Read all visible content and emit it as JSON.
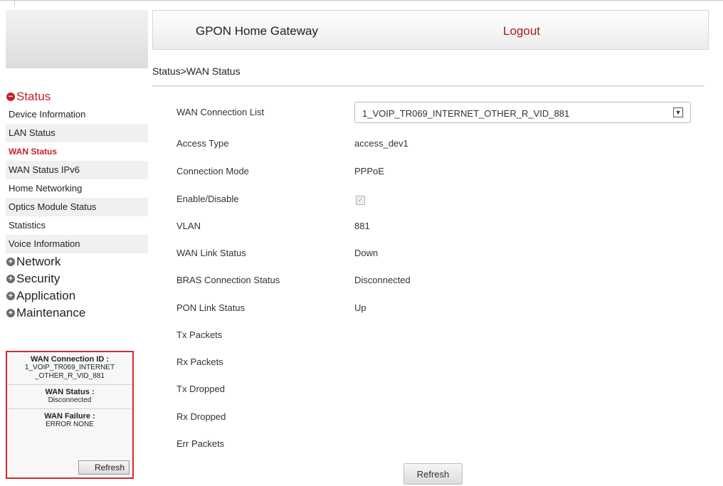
{
  "header": {
    "brand": "GPON Home Gateway",
    "logout": "Logout"
  },
  "breadcrumb": "Status>WAN Status",
  "sidebar": {
    "status": {
      "label": "Status",
      "items": [
        {
          "label": "Device Information"
        },
        {
          "label": "LAN Status"
        },
        {
          "label": "WAN Status"
        },
        {
          "label": "WAN Status IPv6"
        },
        {
          "label": "Home Networking"
        },
        {
          "label": "Optics Module Status"
        },
        {
          "label": "Statistics"
        },
        {
          "label": "Voice Information"
        }
      ]
    },
    "network": "Network",
    "security": "Security",
    "application": "Application",
    "maintenance": "Maintenance"
  },
  "infobox": {
    "conn_title": "WAN Connection ID :",
    "conn_value_1": "1_VOIP_TR069_INTERNET",
    "conn_value_2": "_OTHER_R_VID_881",
    "status_title": "WAN Status :",
    "status_value": "Disconnected",
    "failure_title": "WAN Failure :",
    "failure_value": "ERROR NONE",
    "refresh": "Refresh"
  },
  "main": {
    "conn_list_label": "WAN Connection List",
    "conn_list_value": "1_VOIP_TR069_INTERNET_OTHER_R_VID_881",
    "access_type_label": "Access Type",
    "access_type_value": "access_dev1",
    "conn_mode_label": "Connection Mode",
    "conn_mode_value": "PPPoE",
    "enable_label": "Enable/Disable",
    "enable_checked": true,
    "vlan_label": "VLAN",
    "vlan_value": "881",
    "wan_link_label": "WAN Link Status",
    "wan_link_value": "Down",
    "bras_label": "BRAS Connection Status",
    "bras_value": "Disconnected",
    "pon_label": "PON Link Status",
    "pon_value": "Up",
    "tx_packets_label": "Tx Packets",
    "rx_packets_label": "Rx Packets",
    "tx_dropped_label": "Tx Dropped",
    "rx_dropped_label": "Rx Dropped",
    "err_packets_label": "Err Packets",
    "refresh": "Refresh"
  },
  "icons": {
    "expanded": "minus-circle-icon",
    "collapsed": "plus-circle-icon",
    "dropdown": "chevron-down-icon",
    "check": "check-icon"
  },
  "colors": {
    "accent_red": "#c8202a",
    "logout_red": "#a51c1c",
    "box_border": "#d22c2c"
  }
}
